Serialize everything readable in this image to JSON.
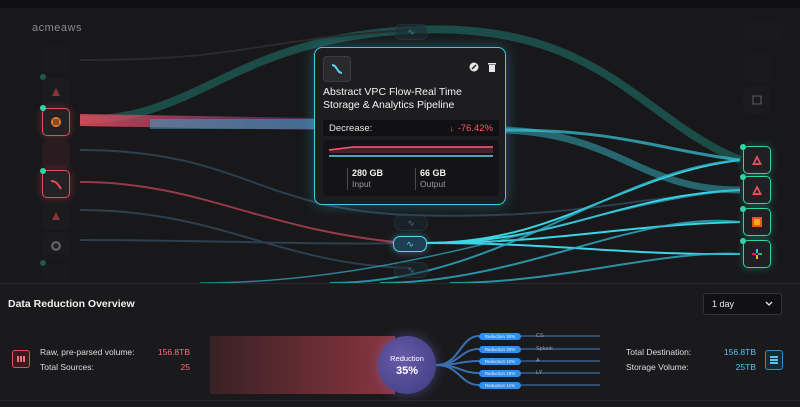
{
  "app": {
    "brand": "acmeaws"
  },
  "pipeline_card": {
    "title": "Abstract VPC Flow-Real Time Storage & Analytics Pipeline",
    "decrease_label": "Decrease:",
    "decrease_value": "-76.42%",
    "input_value": "280 GB",
    "input_label": "Input",
    "output_value": "66 GB",
    "output_label": "Output"
  },
  "overview": {
    "title": "Data Reduction Overview",
    "range_select": "1 day",
    "raw_label": "Raw, pre-parsed volume:",
    "raw_value": "156.8TB",
    "sources_label": "Total Sources:",
    "sources_value": "25",
    "reduction_label": "Reduction",
    "reduction_value": "35%",
    "branches": [
      {
        "tag": "Reduction 30%",
        "value": "CS"
      },
      {
        "tag": "Reduction 30%",
        "value": "Splunk"
      },
      {
        "tag": "Reduction 10%",
        "value": "A"
      },
      {
        "tag": "Reduction 18%",
        "value": "LY"
      },
      {
        "tag": "Reduction 11%",
        "value": ""
      }
    ],
    "destination_label": "Total Destination:",
    "destination_value": "156.8TB",
    "storage_label": "Storage Volume:",
    "storage_value": "25TB"
  },
  "colors": {
    "source_accent": "#e64c5a",
    "destination_accent": "#2fd6a0",
    "pipeline_accent": "#39cfe0",
    "decrease": "#ff5a66"
  }
}
